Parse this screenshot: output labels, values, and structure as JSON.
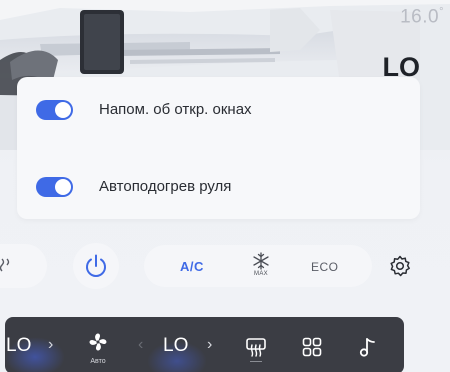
{
  "climate": {
    "temp_right": "16.0",
    "temp_unit": "°",
    "mode_right": "LO"
  },
  "popup": {
    "items": [
      {
        "label": "Напом. об откр. окнах",
        "enabled": true
      },
      {
        "label": "Автоподогрев руля",
        "enabled": true
      }
    ]
  },
  "controls": {
    "ac_label": "A/C",
    "max_label": "MAX",
    "eco_label": "ECO"
  },
  "dock": {
    "left_temp": "LO",
    "fan_label": "Авто",
    "right_temp": "LO",
    "chevron": "›",
    "chevron_left": "‹"
  },
  "colors": {
    "accent": "#3f6ae6",
    "dock_bg": "#3b3d44",
    "card_bg": "#f7f8fa"
  },
  "icons": {
    "partial_left": "seat-heat-icon",
    "power": "power-icon",
    "max": "snowflake-max-icon",
    "settings": "gear-icon",
    "fan": "fan-icon",
    "defrost": "rear-defrost-icon",
    "apps": "apps-grid-icon",
    "music": "music-note-icon"
  }
}
